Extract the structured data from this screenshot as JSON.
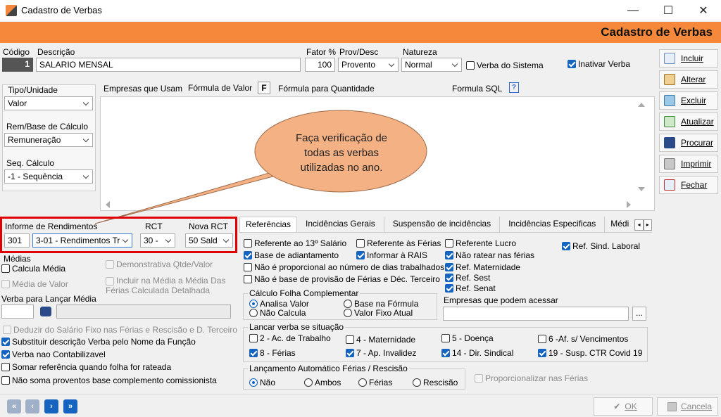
{
  "window": {
    "title": "Cadastro de Verbas",
    "minimize": "—",
    "maximize": "☐",
    "close": "✕"
  },
  "banner": "Cadastro de Verbas",
  "header": {
    "codigo_label": "Código",
    "codigo_value": "1",
    "descricao_label": "Descrição",
    "descricao_value": "SALARIO MENSAL",
    "fator_label": "Fator %",
    "fator_value": "100",
    "provdesc_label": "Prov/Desc",
    "provdesc_value": "Provento",
    "natureza_label": "Natureza",
    "natureza_value": "Normal",
    "verba_sistema": "Verba do Sistema",
    "inativar": "Inativar Verba"
  },
  "left": {
    "tipo_label": "Tipo/Unidade",
    "tipo_value": "Valor",
    "rem_label": "Rem/Base de Cálculo",
    "rem_value": "Remuneração",
    "seq_label": "Seq. Cálculo",
    "seq_value": "-1 - Sequência"
  },
  "formula_tabs": {
    "t1": "Empresas que Usam",
    "t2": "Fórmula de Valor",
    "f": "F",
    "t3": "Fórmula para Quantidade",
    "t4": "Formula SQL",
    "q": "?"
  },
  "callout": "Faça verificação de todas as verbas utilizadas no ano.",
  "informe": {
    "label": "Informe de Rendimentos",
    "code": "301",
    "value": "3-01 - Rendimentos Tr",
    "rct_label": "RCT",
    "rct_value": "30 -",
    "nova_label": "Nova RCT",
    "nova_value": "50 Sald"
  },
  "medias": {
    "label": "Médias",
    "calcula": "Calcula Média",
    "demonstrativa": "Demonstrativa Qtde/Valor",
    "media_valor": "Média de Valor",
    "incluir": "Incluir na Média a Média Das Férias Calculada Detalhada",
    "verba_lancar": "Verba para Lançar Média"
  },
  "bottom_checks": {
    "deduzir": "Deduzir do Salário Fixo nas  Férias e Rescisão e D. Terceiro",
    "substituir": "Substituir descrição Verba pelo Nome da Função",
    "contabilizavel": "Verba nao Contabilizavel",
    "somar": "Somar referência quando folha for rateada",
    "nao_soma": "Não soma proventos base complemento comissionista"
  },
  "ref_tabs": [
    "Referências",
    "Incidências Gerais",
    "Suspensão de incidências",
    "Incidências Especificas",
    "Médi"
  ],
  "refs": {
    "c1": "Referente ao 13º Salário",
    "c2": "Referente às Férias",
    "c3": "Referente Lucro",
    "c4": "Base de adiantamento",
    "c5": "Informar à RAIS",
    "c6": "Não ratear nas férias",
    "c7": "Não é proporcional ao número de dias trabalhados",
    "c8": "Ref. Maternidade",
    "c9": "Não é base de provisão de Férias e Déc. Terceiro",
    "c10": "Ref. Sest",
    "c11": "Ref. Senat",
    "sind": "Ref. Sind. Laboral",
    "calc_label": "Cálculo Folha Complementar",
    "r1": "Analisa Valor",
    "r2": "Base na Fórmula",
    "r3": "Não Calcula",
    "r4": "Valor Fixo Atual",
    "empresas_label": "Empresas que podem acessar",
    "dots": "...",
    "lancar_label": "Lancar verba se situação",
    "s1": "2 - Ac. de Trabalho",
    "s2": "4 - Maternidade",
    "s3": "5 - Doença",
    "s4": "6 -Af. s/ Vencimentos",
    "s5": "8 - Férias",
    "s6": "7 - Ap. Invalidez",
    "s7": "14  - Dir. Sindical",
    "s8": "19 - Susp. CTR Covid 19",
    "auto_label": "Lançamento Automático Férias / Rescisão",
    "a1": "Não",
    "a2": "Ambos",
    "a3": "Férias",
    "a4": "Rescisão",
    "prop": "Proporcionalizar nas Férias"
  },
  "side_buttons": [
    "Incluir",
    "Alterar",
    "Excluir",
    "Atualizar",
    "Procurar",
    "Imprimir",
    "Fechar"
  ],
  "footer": {
    "ok": "OK",
    "cancel": "Cancela",
    "nav": [
      "«",
      "‹",
      "›",
      "»"
    ]
  },
  "colors": {
    "banner": "#f5883a",
    "callout": "#f4b183",
    "highlight": "#e00000",
    "accent": "#1565c0"
  }
}
